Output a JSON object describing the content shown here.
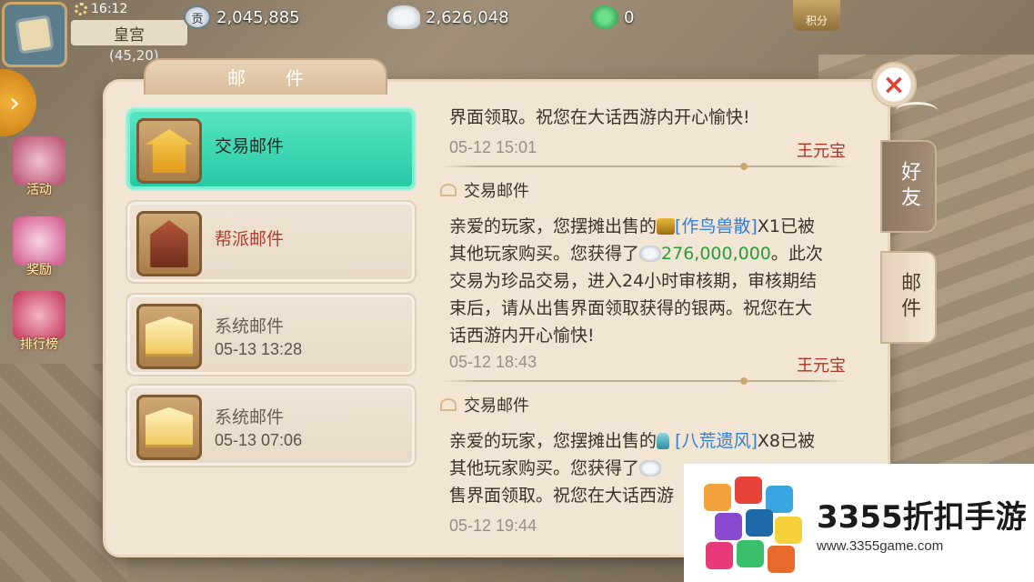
{
  "topbar": {
    "time": "16:12",
    "location": "皇宫",
    "coords": "(45,20)",
    "resources": {
      "contribution": {
        "icon": "contribution-coin-icon",
        "glyph": "贡",
        "value": "2,045,885"
      },
      "silver": {
        "icon": "silver-ingot-icon",
        "value": "2,626,048"
      },
      "jade": {
        "icon": "jade-icon",
        "value": "0"
      }
    },
    "points_label": "积分"
  },
  "side_menu": {
    "expand": "›",
    "items": [
      {
        "label": "活动",
        "icon": "activity-icon"
      },
      {
        "label": "奖励",
        "icon": "gift-icon"
      },
      {
        "label": "排行榜",
        "icon": "ranking-icon"
      }
    ]
  },
  "dialog": {
    "title": "邮件",
    "close": "×",
    "tabs": {
      "friends": "好友",
      "mail": "邮件"
    }
  },
  "mail_list": [
    {
      "title": "交易邮件",
      "date": "",
      "icon": "pavilion-icon",
      "active": true
    },
    {
      "title": "帮派邮件",
      "date": "",
      "icon": "guild-house-icon",
      "active": false
    },
    {
      "title": "系统邮件",
      "date": "05-13 13:28",
      "icon": "envelope-icon",
      "active": false
    },
    {
      "title": "系统邮件",
      "date": "05-13 07:06",
      "icon": "envelope-icon",
      "active": false
    }
  ],
  "messages": {
    "m0": {
      "tail": "界面领取。祝您在大话西游内开心愉快!",
      "time": "05-12 15:01",
      "sender": "王元宝"
    },
    "m1": {
      "heading": "交易邮件",
      "l1_pre": "亲爱的玩家，您摆摊出售的",
      "l1_item": "[作鸟兽散]",
      "l1_post": "X1已被",
      "l2_pre": "其他玩家购买。您获得了",
      "l2_amount": "276,000,000",
      "l2_post": "。此次",
      "l3": "交易为珍品交易，进入24小时审核期，审核期结",
      "l4": "束后，请从出售界面领取获得的银两。祝您在大",
      "l5": "话西游内开心愉快!",
      "time": "05-12 18:43",
      "sender": "王元宝"
    },
    "m2": {
      "heading": "交易邮件",
      "l1_pre": "亲爱的玩家，您摆摊出售的",
      "l1_item": "[八荒遗风]",
      "l1_post": "X8已被",
      "l2_pre": "其他玩家购买。您获得了",
      "l3": "售界面领取。祝您在大话西游",
      "time": "05-12 19:44"
    }
  },
  "watermark": {
    "brand": "3355折扣手游",
    "url": "www.3355game.com"
  }
}
